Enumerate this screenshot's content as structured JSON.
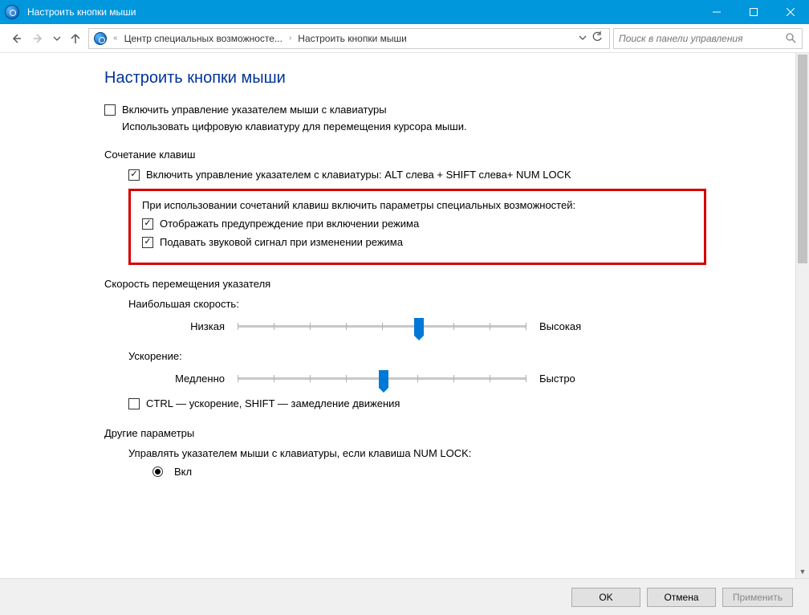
{
  "window": {
    "title": "Настроить кнопки мыши"
  },
  "nav": {
    "crumb1": "Центр специальных возможносте...",
    "crumb2": "Настроить кнопки мыши",
    "search_placeholder": "Поиск в панели управления"
  },
  "page": {
    "title": "Настроить кнопки мыши",
    "enable_pointer_kb": "Включить управление указателем мыши с клавиатуры",
    "helper": "Использовать цифровую клавиатуру для перемещения курсора мыши.",
    "section_shortcut": "Сочетание клавиш",
    "enable_shortcut": "Включить управление указателем с клавиатуры: ALT слева + SHIFT слева+ NUM LOCK",
    "box_intro": "При использовании сочетаний клавиш включить параметры специальных возможностей:",
    "box_opt1": "Отображать предупреждение при включении режима",
    "box_opt2": "Подавать звуковой сигнал при изменении режима",
    "section_speed": "Скорость перемещения указателя",
    "max_speed_label": "Наибольшая скорость:",
    "low": "Низкая",
    "high": "Высокая",
    "accel_label": "Ускорение:",
    "slow": "Медленно",
    "fast": "Быстро",
    "ctrl_shift": "CTRL — ускорение, SHIFT — замедление движения",
    "section_other": "Другие параметры",
    "numlock_label": "Управлять указателем мыши с клавиатуры, если клавиша NUM LOCK:",
    "radio_on": "Вкл"
  },
  "footer": {
    "ok": "OK",
    "cancel": "Отмена",
    "apply": "Применить"
  }
}
